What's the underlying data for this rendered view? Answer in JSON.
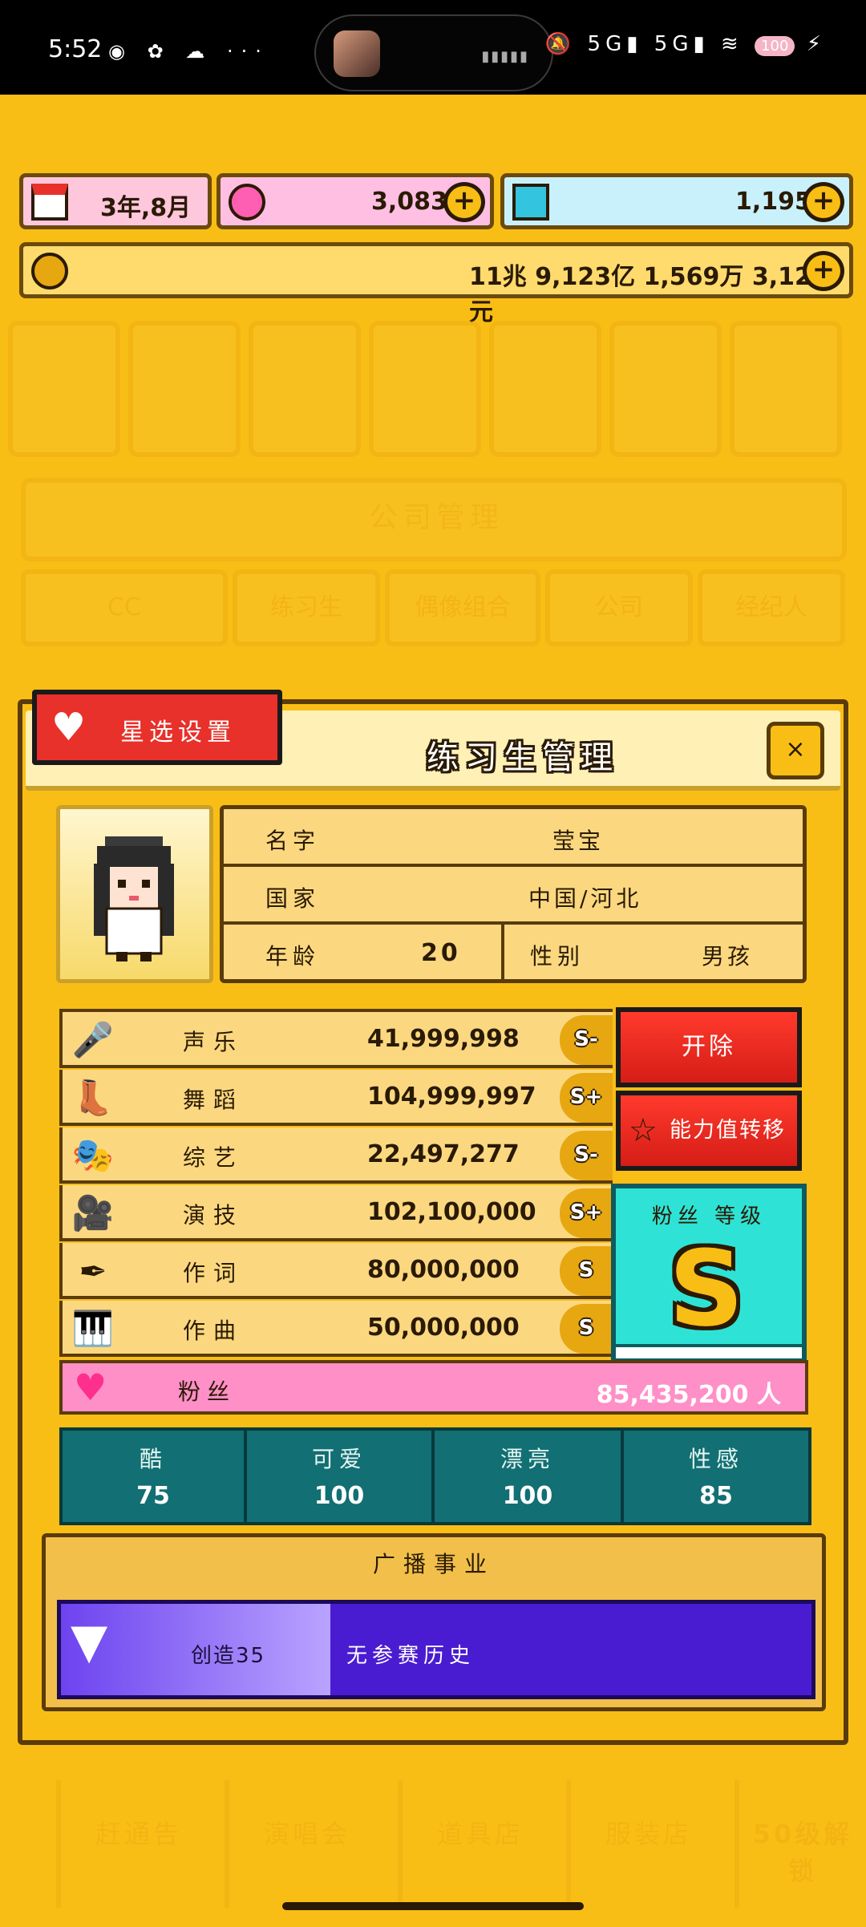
{
  "status_bar": {
    "time": "5:52",
    "left_icons": "◉ ✿ ☁ ···",
    "right_icons": "🔕 5G▮ 5G▮ ≋",
    "battery": "100",
    "charging": "⚡"
  },
  "resources": {
    "date": "3年,8月",
    "pink_gems": "3,083",
    "diamonds": "1,195",
    "money": "11兆 9,123亿 1,569万 3,120元",
    "plus": "+"
  },
  "background": {
    "panel_title": "公司管理",
    "tabs": [
      "CC",
      "练习生",
      "偶像组合",
      "公司",
      "经纪人"
    ],
    "bottom_nav": [
      "解",
      "赶通告",
      "演唱会",
      "道具店",
      "服装店",
      "50级解锁"
    ]
  },
  "modal": {
    "title": "练习生管理",
    "close": "×",
    "star_select_button": "星选设置",
    "profile": {
      "name_label": "名字",
      "name": "莹宝",
      "country_label": "国家",
      "country": "中国/河北",
      "age_label": "年龄",
      "age": "20",
      "gender_label": "性别",
      "gender": "男孩"
    },
    "skills": [
      {
        "icon": "microphone-icon",
        "name": "声乐",
        "value": "41,999,998",
        "grade": "S-"
      },
      {
        "icon": "shoe-icon",
        "name": "舞蹈",
        "value": "104,999,997",
        "grade": "S+"
      },
      {
        "icon": "mask-icon",
        "name": "综艺",
        "value": "22,497,277",
        "grade": "S-"
      },
      {
        "icon": "camera-icon",
        "name": "演技",
        "value": "102,100,000",
        "grade": "S+"
      },
      {
        "icon": "pen-icon",
        "name": "作词",
        "value": "80,000,000",
        "grade": "S"
      },
      {
        "icon": "piano-icon",
        "name": "作曲",
        "value": "50,000,000",
        "grade": "S"
      }
    ],
    "dismiss_button": "开除",
    "transfer_button": "能力值转移",
    "fan_level_label": "粉丝 等级",
    "fan_level": "S",
    "fans_label": "粉丝",
    "fans_value": "85,435,200 人",
    "traits": [
      {
        "label": "酷",
        "value": "75"
      },
      {
        "label": "可爱",
        "value": "100"
      },
      {
        "label": "漂亮",
        "value": "100"
      },
      {
        "label": "性感",
        "value": "85"
      }
    ],
    "broadcast": {
      "title": "广播事业",
      "create": "创造35",
      "history": "无参赛历史"
    }
  },
  "colors": {
    "background": "#F9BE16",
    "pink_gem": "#FF7FC0",
    "diamond": "#33C4E0",
    "red_button": "#E8312A",
    "teal": "#126F73",
    "fan_level_bg": "#2EE3D6",
    "broadcast_bar": "#4A1CD1"
  }
}
